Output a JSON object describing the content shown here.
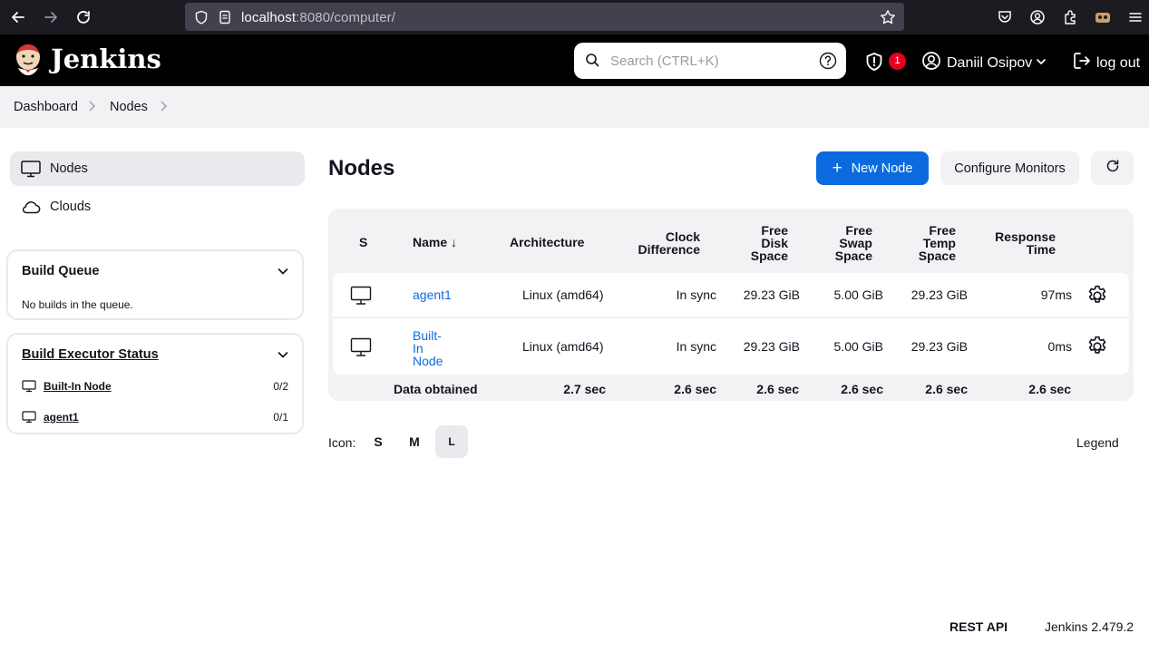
{
  "browser": {
    "url_host": "localhost",
    "url_rest": ":8080/computer/"
  },
  "header": {
    "brand": "Jenkins",
    "search_placeholder": "Search (CTRL+K)",
    "security_count": "1",
    "user_name": "Daniil Osipov",
    "logout_label": "log out"
  },
  "breadcrumb": [
    "Dashboard",
    "Nodes"
  ],
  "sidebar": {
    "items": [
      {
        "label": "Nodes",
        "icon": "computer-icon",
        "active": true
      },
      {
        "label": "Clouds",
        "icon": "cloud-icon",
        "active": false
      }
    ],
    "build_queue": {
      "title": "Build Queue",
      "empty_text": "No builds in the queue."
    },
    "executor_status": {
      "title": "Build Executor Status",
      "rows": [
        {
          "name": "Built-In Node",
          "count": "0/2"
        },
        {
          "name": "agent1",
          "count": "0/1"
        }
      ]
    }
  },
  "main": {
    "title": "Nodes",
    "new_node_label": "New Node",
    "configure_monitors_label": "Configure Monitors",
    "table": {
      "headers": {
        "s": "S",
        "name": "Name ↓",
        "architecture": "Architecture",
        "clock_1": "Clock",
        "clock_2": "Difference",
        "disk_1": "Free",
        "disk_2": "Disk",
        "disk_3": "Space",
        "swap_1": "Free",
        "swap_2": "Swap",
        "swap_3": "Space",
        "temp_1": "Free",
        "temp_2": "Temp",
        "temp_3": "Space",
        "resp_1": "Response",
        "resp_2": "Time"
      },
      "rows": [
        {
          "name": "agent1",
          "architecture": "Linux (amd64)",
          "clock": "In sync",
          "disk": "29.23 GiB",
          "swap": "5.00 GiB",
          "temp": "29.23 GiB",
          "response": "97ms"
        },
        {
          "name_1": "Built-",
          "name_2": "In",
          "name_3": "Node",
          "architecture": "Linux (amd64)",
          "clock": "In sync",
          "disk": "29.23 GiB",
          "swap": "5.00 GiB",
          "temp": "29.23 GiB",
          "response": "0ms"
        }
      ],
      "footer": {
        "label": "Data obtained",
        "architecture": "2.7 sec",
        "clock": "2.6 sec",
        "disk": "2.6 sec",
        "swap": "2.6 sec",
        "temp": "2.6 sec",
        "response": "2.6 sec"
      }
    },
    "icon_label": "Icon:",
    "icon_sizes": [
      "S",
      "M",
      "L"
    ],
    "selected_icon_size": "L",
    "legend_label": "Legend"
  },
  "footer": {
    "rest_api": "REST API",
    "version": "Jenkins 2.479.2"
  },
  "colors": {
    "accent": "#0b6bde",
    "header_bg": "#000000",
    "badge": "#e6001f"
  }
}
